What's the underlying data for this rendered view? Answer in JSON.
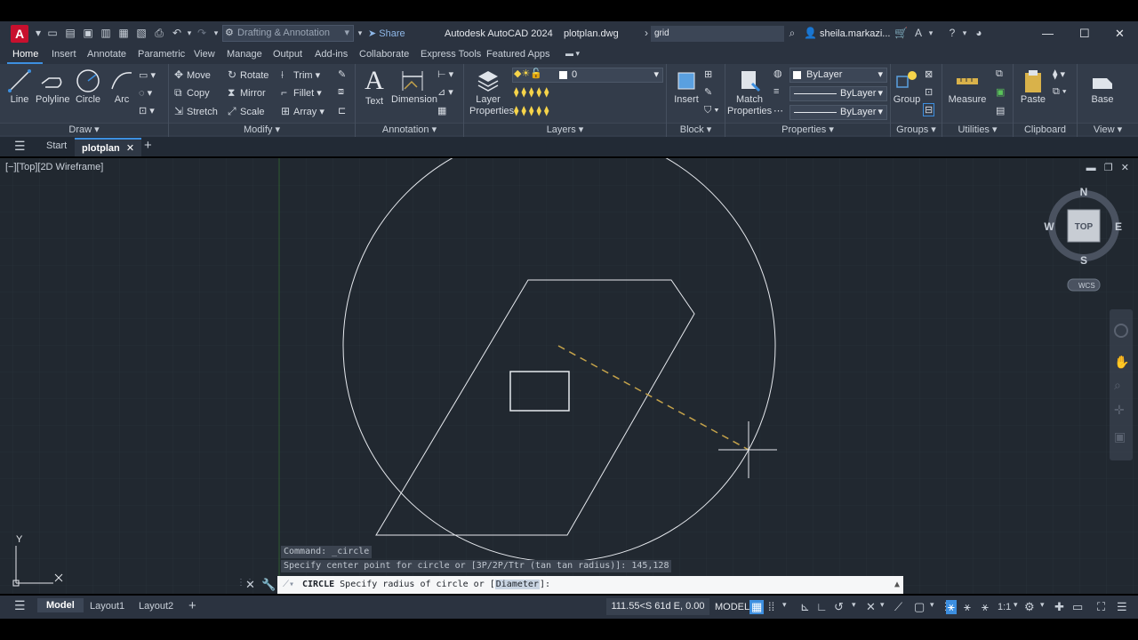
{
  "titlebar": {
    "workspace": "Drafting & Annotation",
    "share": "Share",
    "app_title": "Autodesk AutoCAD 2024",
    "file_name": "plotplan.dwg",
    "search_value": "grid",
    "user": "sheila.markazi..."
  },
  "tabs": [
    "Home",
    "Insert",
    "Annotate",
    "Parametric",
    "View",
    "Manage",
    "Output",
    "Add-ins",
    "Collaborate",
    "Express Tools",
    "Featured Apps"
  ],
  "ribbon": {
    "draw": {
      "title": "Draw",
      "line": "Line",
      "polyline": "Polyline",
      "circle": "Circle",
      "arc": "Arc"
    },
    "modify": {
      "title": "Modify",
      "move": "Move",
      "rotate": "Rotate",
      "trim": "Trim",
      "copy": "Copy",
      "mirror": "Mirror",
      "fillet": "Fillet",
      "stretch": "Stretch",
      "scale": "Scale",
      "array": "Array"
    },
    "annotation": {
      "title": "Annotation",
      "text": "Text",
      "dimension": "Dimension"
    },
    "layers": {
      "title": "Layers",
      "layer_properties": "Layer Properties",
      "current_layer": "0"
    },
    "block": {
      "title": "Block",
      "insert": "Insert"
    },
    "properties": {
      "title": "Properties",
      "match": "Match Properties",
      "color": "ByLayer",
      "linetype": "ByLayer",
      "lineweight": "ByLayer"
    },
    "groups": {
      "title": "Groups",
      "group": "Group"
    },
    "utilities": {
      "title": "Utilities",
      "measure": "Measure"
    },
    "clipboard": {
      "title": "Clipboard",
      "paste": "Paste"
    },
    "view": {
      "title": "View",
      "base": "Base"
    }
  },
  "filetabs": {
    "start": "Start",
    "current": "plotplan"
  },
  "viewport": {
    "label": "[−][Top][2D Wireframe]",
    "viewcube": {
      "n": "N",
      "s": "S",
      "e": "E",
      "w": "W",
      "top": "TOP",
      "wcs": "WCS"
    },
    "ucs_y": "Y"
  },
  "command": {
    "history1": "Command: _circle",
    "history2": "Specify center point for circle or [3P/2P/Ttr (tan tan radius)]: 145,128",
    "name": "CIRCLE",
    "prompt": "Specify radius of circle or [",
    "option": "Diameter",
    "prompt_end": "]:"
  },
  "statusbar": {
    "layouts": [
      "Model",
      "Layout1",
      "Layout2"
    ],
    "coords": "111.55<S 61d E, 0.00",
    "space": "MODEL",
    "scale": "1:1"
  },
  "colors": {
    "accent": "#3d8fe0",
    "canvas": "#212830",
    "rubber_band": "#c4a24a"
  }
}
